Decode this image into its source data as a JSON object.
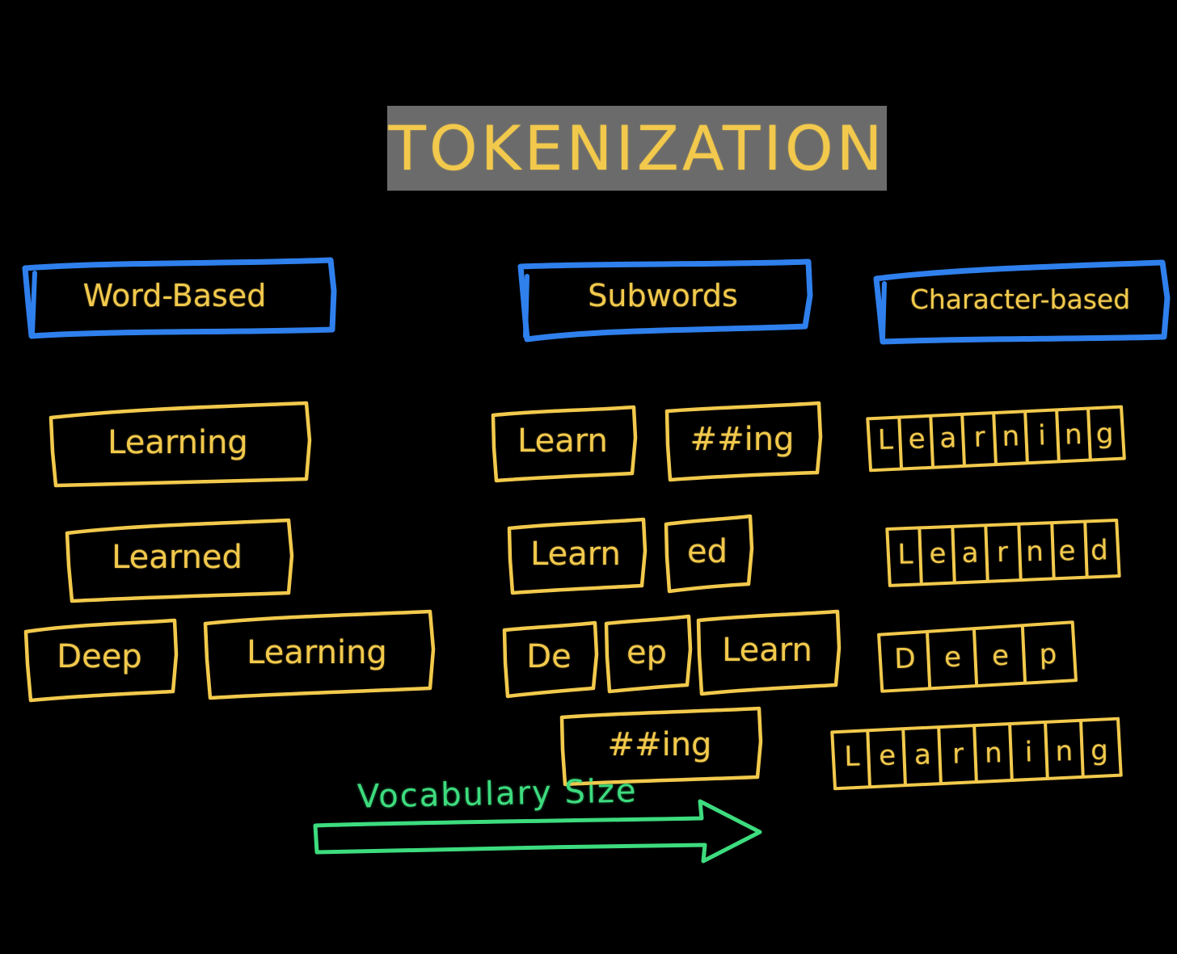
{
  "board": {
    "background_color": "#000000",
    "ink_yellow": "#f2c94c",
    "ink_blue": "#2f80ed",
    "ink_green": "#3ddc7e",
    "title_highlight_color": "#6b6b6b"
  },
  "title": {
    "text": "TOKENIZATION"
  },
  "columns": [
    {
      "id": "word-based",
      "header": "Word-Based"
    },
    {
      "id": "subwords",
      "header": "Subwords"
    },
    {
      "id": "character-based",
      "header": "Character-based"
    }
  ],
  "rows": [
    {
      "source_word": "Learning",
      "word_based": [
        "Learning"
      ],
      "subwords": [
        "Learn",
        "##ing"
      ],
      "character_based": [
        "L",
        "e",
        "a",
        "r",
        "n",
        "i",
        "n",
        "g"
      ]
    },
    {
      "source_word": "Learned",
      "word_based": [
        "Learned"
      ],
      "subwords": [
        "Learn",
        "ed"
      ],
      "character_based": [
        "L",
        "e",
        "a",
        "r",
        "n",
        "e",
        "d"
      ]
    },
    {
      "source_word": "Deep Learning",
      "word_based": [
        "Deep",
        "Learning"
      ],
      "subwords": [
        "De",
        "ep",
        "Learn",
        "##ing"
      ],
      "character_based_line1": [
        "D",
        "e",
        "e",
        "p"
      ],
      "character_based_line2": [
        "L",
        "e",
        "a",
        "r",
        "n",
        "i",
        "n",
        "g"
      ]
    }
  ],
  "tokens": {
    "w_r1_c1": "Learning",
    "w_r2_c1": "Learned",
    "w_r3_c1": "Deep",
    "w_r3_c2": "Learning",
    "s_r1_c1": "Learn",
    "s_r1_c2": "##ing",
    "s_r2_c1": "Learn",
    "s_r2_c2": "ed",
    "s_r3_c1": "De",
    "s_r3_c2": "ep",
    "s_r3_c3": "Learn",
    "s_r4_c1": "##ing"
  },
  "axis": {
    "label": "Vocabulary Size",
    "direction": "increasing-to-the-right"
  }
}
